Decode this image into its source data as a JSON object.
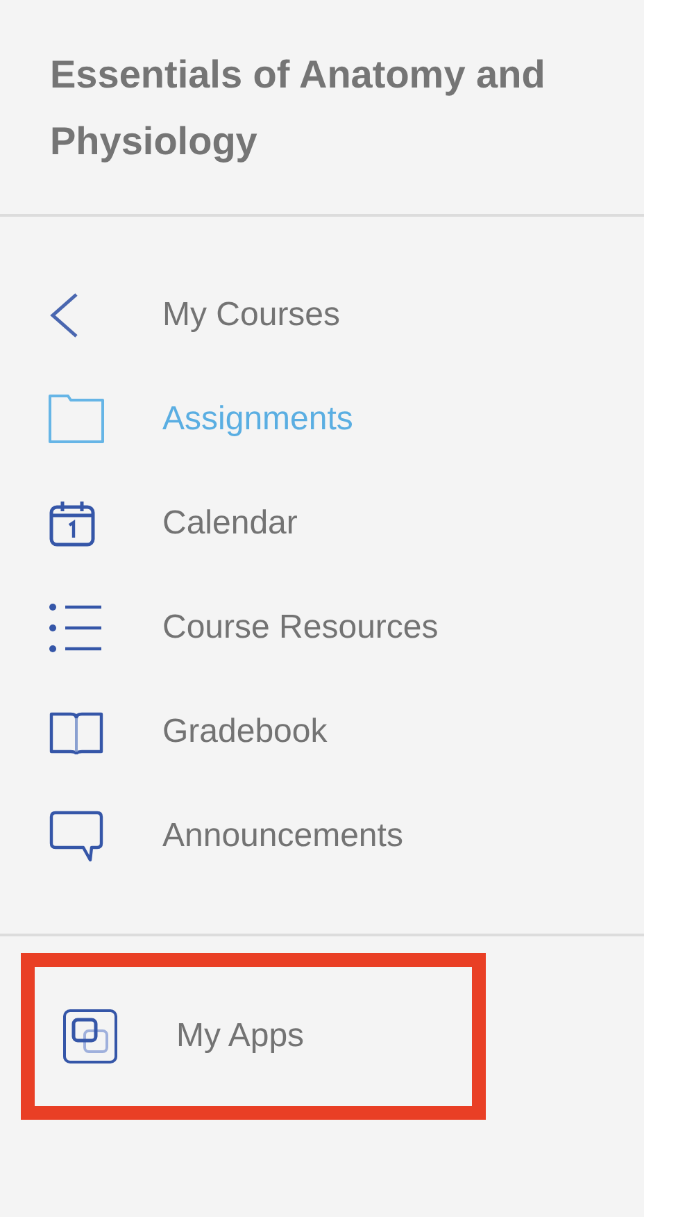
{
  "course_title": "Essentials of Anatomy and Physiology",
  "nav_items": [
    {
      "label": "My Courses",
      "selected": false
    },
    {
      "label": "Assignments",
      "selected": true
    },
    {
      "label": "Calendar",
      "selected": false
    },
    {
      "label": "Course Resources",
      "selected": false
    },
    {
      "label": "Gradebook",
      "selected": false
    },
    {
      "label": "Announcements",
      "selected": false
    }
  ],
  "app_items": [
    {
      "label": "My Apps",
      "selected": false,
      "highlighted": true
    }
  ]
}
